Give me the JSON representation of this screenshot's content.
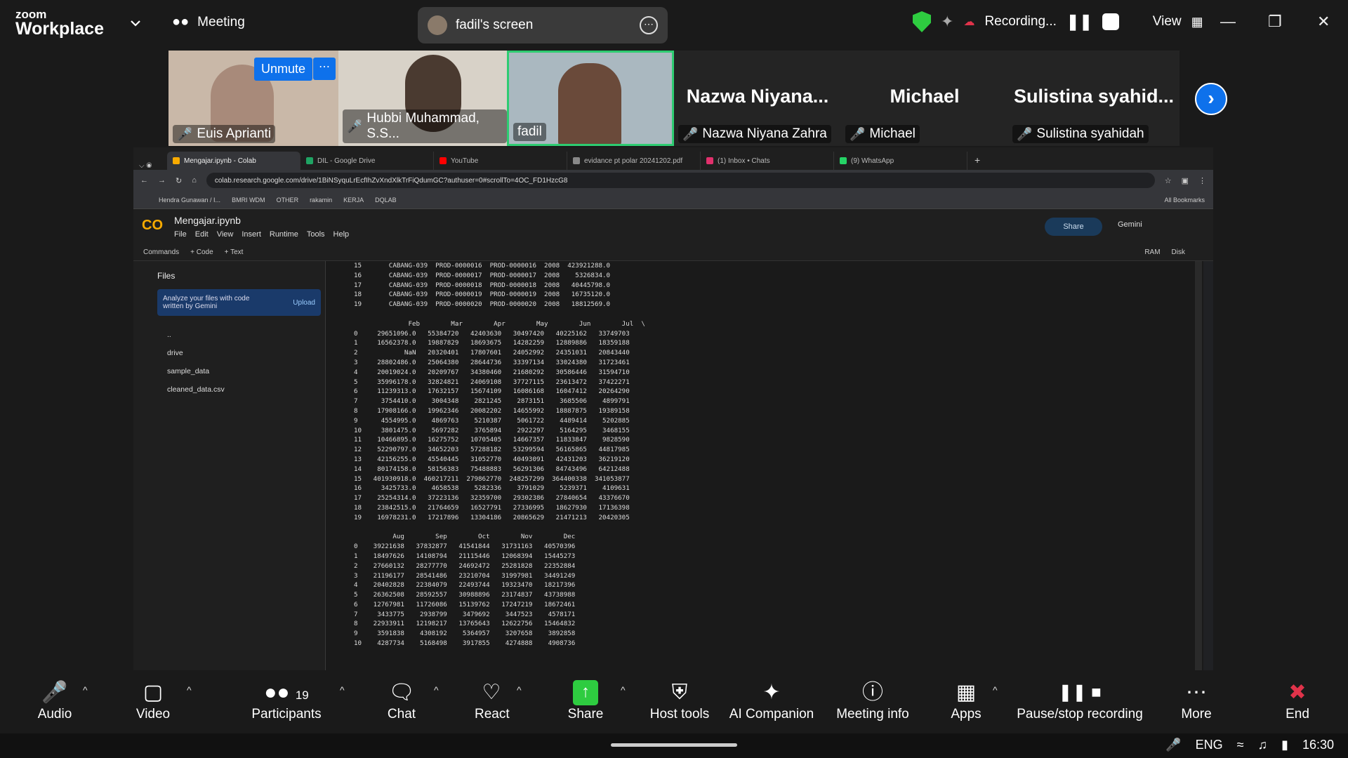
{
  "zoom": {
    "brand_top": "zoom",
    "brand_bottom": "Workplace",
    "meeting_label": "Meeting",
    "screen_label": "fadil's screen",
    "recording_label": "Recording...",
    "view_label": "View",
    "unmute_label": "Unmute"
  },
  "participants_tiles": [
    {
      "name": "Euis Aprianti",
      "big": ""
    },
    {
      "name": "Hubbi Muhammad, S.S...",
      "big": ""
    },
    {
      "name": "fadil",
      "big": ""
    },
    {
      "name": "Nazwa Niyana Zahra",
      "big": "Nazwa  Niyana..."
    },
    {
      "name": "Michael",
      "big": "Michael"
    },
    {
      "name": "Sulistina syahidah",
      "big": "Sulistina  syahid..."
    }
  ],
  "browser": {
    "tabs": [
      {
        "label": "Mengajar.ipynb - Colab",
        "color": "#f9ab00"
      },
      {
        "label": "DIL - Google Drive",
        "color": "#1fa463"
      },
      {
        "label": "YouTube",
        "color": "#ff0000"
      },
      {
        "label": "evidance pt polar 20241202.pdf",
        "color": "#888888"
      },
      {
        "label": "(1) Inbox • Chats",
        "color": "#e1306c"
      },
      {
        "label": "(9) WhatsApp",
        "color": "#25d366"
      }
    ],
    "url": "colab.research.google.com/drive/1BiNSyquLrEcfIhZvXndXlkTrFiQdumGC?authuser=0#scrollTo=4OC_FD1HzcG8",
    "bookmarks": [
      "Hendra Gunawan / I...",
      "BMRI WDM",
      "OTHER",
      "rakamin",
      "KERJA",
      "DQLAB"
    ],
    "all_bookmarks": "All Bookmarks"
  },
  "colab": {
    "notebook": "Mengajar.ipynb",
    "menu": [
      "File",
      "Edit",
      "View",
      "Insert",
      "Runtime",
      "Tools",
      "Help"
    ],
    "commands": "Commands",
    "code": "+ Code",
    "text": "+ Text",
    "share": "Share",
    "gemini": "Gemini",
    "ram": "RAM",
    "disk": "Disk",
    "files_title": "Files",
    "gem_box": "Analyze your files with code written by Gemini",
    "upload": "Upload",
    "tree": [
      "..",
      "drive",
      "sample_data",
      "cleaned_data.csv"
    ],
    "output": "15       CABANG-039  PROD-0000016  PROD-0000016  2008  423921288.0\n16       CABANG-039  PROD-0000017  PROD-0000017  2008    5326834.0\n17       CABANG-039  PROD-0000018  PROD-0000018  2008   40445798.0\n18       CABANG-039  PROD-0000019  PROD-0000019  2008   16735120.0\n19       CABANG-039  PROD-0000020  PROD-0000020  2008   18812569.0\n\n              Feb        Mar        Apr        May        Jun        Jul  \\\n0     29651096.0   55384720   42403630   30497420   40225162   33749703\n1     16562378.0   19887829   18693675   14282259   12889886   18359188\n2            NaN   20320401   17807601   24052992   24351031   20843440\n3     28802486.0   25064380   28644736   33397134   33024380   31723461\n4     20019024.0   20209767   34380460   21680292   30586446   31594710\n5     35996178.0   32824821   24069108   37727115   23613472   37422271\n6     11239313.0   17632157   15674109   16086168   16047412   20264290\n7      3754410.0    3004348    2821245    2873151    3685506    4899791\n8     17908166.0   19962346   20082202   14655992   18887875   19389158\n9      4554995.0    4869763    5210387    5061722    4489414    5202885\n10     3801475.0    5697282    3765894    2922297    5164295    3468155\n11    10466895.0   16275752   10705405   14667357   11833847    9828590\n12    52290797.0   34652203   57288182   53299594   56165865   44817985\n13    42156255.0   45540445   31052770   40493091   42431203   36219120\n14    80174158.0   58156383   75488883   56291306   84743496   64212488\n15   401930918.0  460217211  279862770  248257299  364400338  341053877\n16     3425733.0    4658538    5282336    3791029    5239371    4109631\n17    25254314.0   37223136   32359700   29302386   27840654   43376670\n18    23842515.0   21764659   16527791   27336995   18627930   17136398\n19    16978231.0   17217896   13304186   20865629   21471213   20420305\n\n          Aug        Sep        Oct        Nov        Dec\n0    39221638   37832877   41541844   31731163   40570396\n1    18497626   14108794   21115446   12068394   15445273\n2    27660132   28277770   24692472   25281828   22352884\n3    21196177   28541486   23210704   31997981   34491249\n4    20402828   22384079   22493744   19323470   18217396\n5    26362508   28592557   30988896   23174837   43738988\n6    12767981   11726086   15139762   17247219   18672461\n7     3433775    2938799    3479692    3447523    4578171\n8    22933911   12198217   13765643   12622756   15464832\n9     3591838    4308192    5364957    3207658    3892858\n10    4287734    5168498    3917855    4274888    4908736"
  },
  "bottom": {
    "audio": "Audio",
    "video": "Video",
    "participants": "Participants",
    "participants_count": "19",
    "chat": "Chat",
    "react": "React",
    "share": "Share",
    "host_tools": "Host tools",
    "ai": "AI Companion",
    "info": "Meeting info",
    "apps": "Apps",
    "pause": "Pause/stop recording",
    "more": "More",
    "end": "End"
  },
  "taskbar": {
    "lang": "ENG",
    "time": "16:30"
  }
}
